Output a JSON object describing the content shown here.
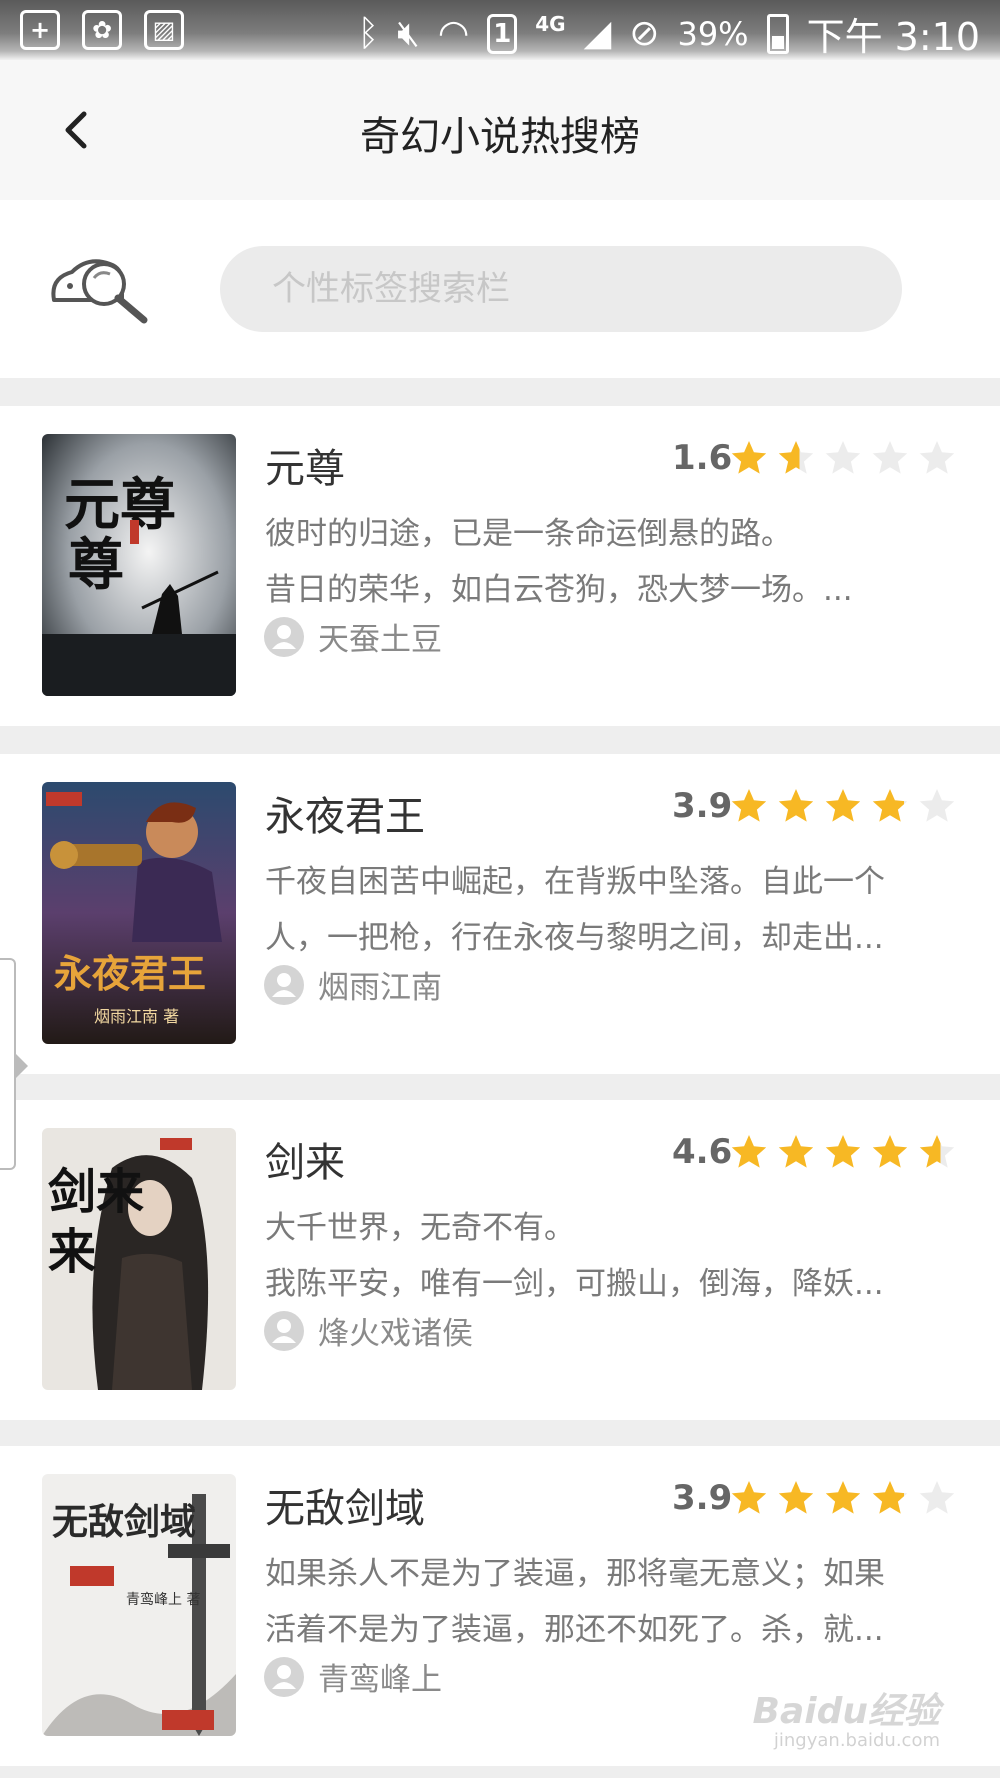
{
  "status_bar": {
    "battery": "39%",
    "network": "4G",
    "sim": "1",
    "time": "下午 3:10"
  },
  "header": {
    "title": "奇幻小说热搜榜"
  },
  "search": {
    "placeholder": "个性标签搜索栏"
  },
  "colors": {
    "star_full": "#f7b824",
    "star_empty": "#ececec",
    "section_gap": "#eeeeee"
  },
  "books": [
    {
      "title": "元尊",
      "rating": "1.6",
      "rating_value": 1.6,
      "desc_lines": [
        "彼时的归途，已是一条命运倒悬的路。",
        "昔日的荣华，如白云苍狗，恐大梦一场。..."
      ],
      "author": "天蚕土豆",
      "cover_text": "元尊"
    },
    {
      "title": "永夜君王",
      "rating": "3.9",
      "rating_value": 3.9,
      "desc_lines": [
        "千夜自困苦中崛起，在背叛中坠落。自此一个",
        "人，一把枪，行在永夜与黎明之间，却走出..."
      ],
      "author": "烟雨江南",
      "cover_text": "永夜君王",
      "cover_subtext": "烟雨江南 著"
    },
    {
      "title": "剑来",
      "rating": "4.6",
      "rating_value": 4.6,
      "desc_lines": [
        "大千世界，无奇不有。",
        " 我陈平安，唯有一剑，可搬山，倒海，降妖..."
      ],
      "author": "烽火戏诸侯",
      "cover_text": "剑来"
    },
    {
      "title": "无敌剑域",
      "rating": "3.9",
      "rating_value": 3.9,
      "desc_lines": [
        "如果杀人不是为了装逼，那将毫无意义；如果",
        "活着不是为了装逼，那还不如死了。杀，就..."
      ],
      "author": "青鸾峰上",
      "cover_text": "无敌剑域",
      "cover_subtext": "青鸾峰上 著"
    }
  ],
  "watermark": {
    "brand": "Baidu经验",
    "url": "jingyan.baidu.com"
  }
}
